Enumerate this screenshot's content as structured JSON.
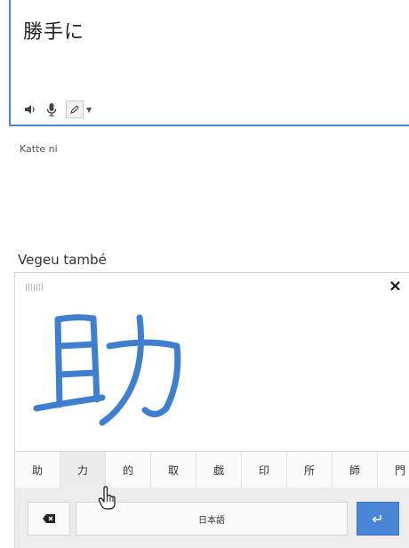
{
  "source": {
    "text": "勝手に",
    "toolbar": {
      "listen_icon": "speaker-icon",
      "mic_icon": "microphone-icon",
      "handwrite_icon": "pencil-icon",
      "dropdown_icon": "caret-down-icon"
    }
  },
  "romanization": "Katte ni",
  "see_also": "Vegeu també",
  "handwriting": {
    "close_label": "×",
    "ink_color": "#3f7fcf",
    "candidates": [
      "助",
      "力",
      "的",
      "取",
      "戯",
      "印",
      "所",
      "師",
      "門"
    ],
    "language_label": "日本語",
    "enter_label": "↵"
  }
}
